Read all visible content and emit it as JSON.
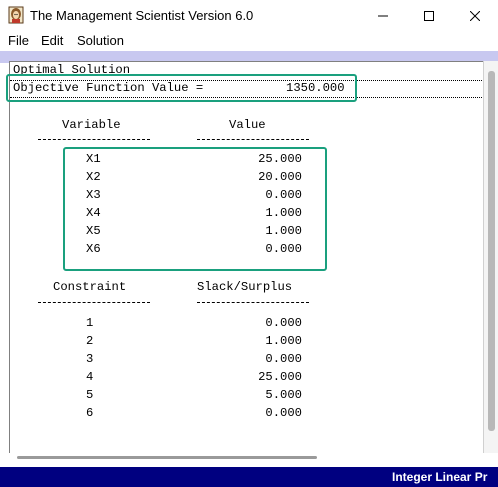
{
  "window": {
    "title": "The Management Scientist Version 6.0"
  },
  "menu": {
    "items": [
      "File",
      "Edit",
      "Solution"
    ]
  },
  "report": {
    "heading": "Optimal Solution",
    "objective_label": "Objective Function Value =",
    "objective_value": "1350.000",
    "variable_header": "Variable",
    "value_header": "Value",
    "variables": [
      {
        "name": "X1",
        "value": "25.000"
      },
      {
        "name": "X2",
        "value": "20.000"
      },
      {
        "name": "X3",
        "value": "0.000"
      },
      {
        "name": "X4",
        "value": "1.000"
      },
      {
        "name": "X5",
        "value": "1.000"
      },
      {
        "name": "X6",
        "value": "0.000"
      }
    ],
    "constraint_header": "Constraint",
    "slack_header": "Slack/Surplus",
    "constraints": [
      {
        "id": "1",
        "value": "0.000"
      },
      {
        "id": "2",
        "value": "1.000"
      },
      {
        "id": "3",
        "value": "0.000"
      },
      {
        "id": "4",
        "value": "25.000"
      },
      {
        "id": "5",
        "value": "5.000"
      },
      {
        "id": "6",
        "value": "0.000"
      }
    ]
  },
  "status": {
    "text": "Integer Linear Pr"
  },
  "colors": {
    "highlight": "#1aa07e",
    "status_bar": "#000080",
    "band": "#c8c8f0"
  },
  "icons": [
    "app-icon",
    "minimize-icon",
    "maximize-icon",
    "close-icon"
  ]
}
